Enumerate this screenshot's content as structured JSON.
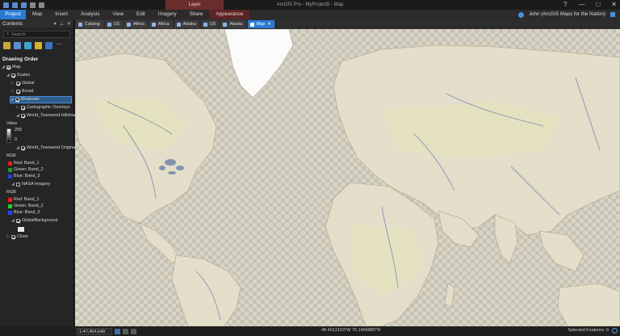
{
  "window": {
    "title": "ArcGIS Pro - MyProject5 - Map",
    "context_tab": "Layer",
    "controls": [
      "?",
      "—",
      "□",
      "✕"
    ]
  },
  "ribbon": {
    "tabs": [
      "Project",
      "Map",
      "Insert",
      "Analysis",
      "View",
      "Edit",
      "Imagery",
      "Share",
      "Appearance"
    ],
    "account": "John (ArcGIS Maps for the Nation)"
  },
  "contents": {
    "title": "Contents",
    "search_placeholder": "Search",
    "drawing_order": "Drawing Order",
    "tree": {
      "map": "Map",
      "scales": "Scales",
      "global": "Global",
      "broad": "Broad",
      "moderate": "Moderate",
      "cartographic_overlays": "Cartographic Overlays",
      "hillshade": "World_Townsend Hillshade",
      "value_label": "Value",
      "value_high": "255",
      "value_low": "0",
      "townsend_original": "World_Townsend Original",
      "rgb1": "RGB",
      "red1": "Red: Band_1",
      "green1": "Green: Band_2",
      "blue1": "Blue: Band_3",
      "nasa": "NASA Imagery",
      "rgb2": "RGB",
      "red2": "Red: Band_1",
      "green2": "Green: Band_2",
      "blue2": "Blue: Band_3",
      "global_background": "GlobalBackground",
      "close": "Close"
    }
  },
  "map_tabs": [
    "Catalog",
    "US",
    "Africa",
    "Africa",
    "Alaska",
    "US",
    "Alaska",
    "Map"
  ],
  "status": {
    "scale": "1:47,454,648",
    "coords": "48.4012163°W 75.1466880°N",
    "selected": "Selected Features: 0"
  },
  "colors": {
    "accent": "#2a7ad3",
    "context": "#6b2d2d",
    "selection": "#2e5d8c",
    "red_band": "#e02020",
    "green_band": "#1fa01f",
    "blue_band": "#2040e0"
  }
}
